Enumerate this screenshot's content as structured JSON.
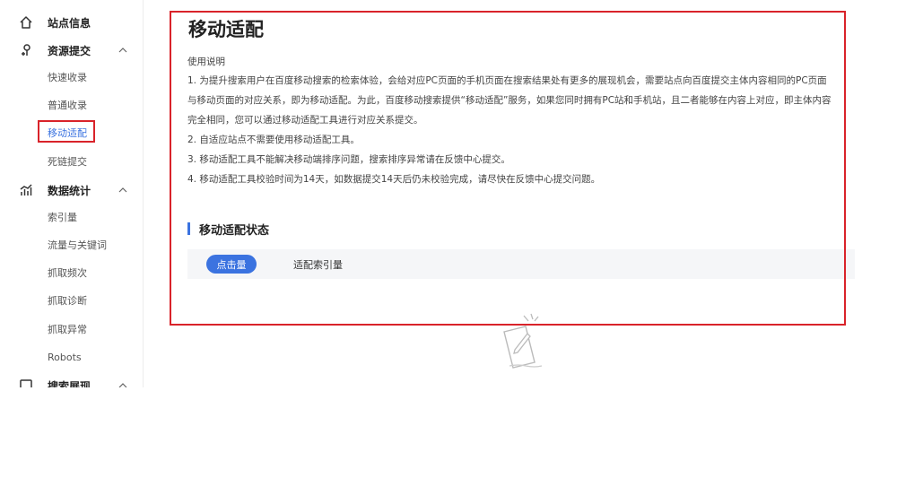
{
  "sidebar": {
    "groups": [
      {
        "label": "站点信息",
        "icon": "home-icon"
      },
      {
        "label": "资源提交",
        "icon": "submit-icon",
        "expanded": true,
        "items": [
          "快速收录",
          "普通收录",
          "移动适配",
          "死链提交"
        ]
      },
      {
        "label": "数据统计",
        "icon": "chart-icon",
        "expanded": true,
        "items": [
          "索引量",
          "流量与关键词",
          "抓取频次",
          "抓取诊断",
          "抓取异常",
          "Robots"
        ]
      },
      {
        "label": "搜索展现",
        "icon": "display-icon"
      }
    ],
    "active_item": "移动适配"
  },
  "main": {
    "title": "移动适配",
    "usage_title": "使用说明",
    "paragraphs": [
      "1. 为提升搜索用户在百度移动搜索的检索体验，会给对应PC页面的手机页面在搜索结果处有更多的展现机会，需要站点向百度提交主体内容相同的PC页面",
      "与移动页面的对应关系，即为移动适配。为此，百度移动搜索提供“移动适配”服务，如果您同时拥有PC站和手机站，且二者能够在内容上对应，即主体内容",
      "完全相同，您可以通过移动适配工具进行对应关系提交。",
      "2. 自适应站点不需要使用移动适配工具。",
      "3. 移动适配工具不能解决移动端排序问题，搜索排序异常请在反馈中心提交。",
      "4. 移动适配工具校验时间为14天，如数据提交14天后仍未校验完成，请尽快在反馈中心提交问题。"
    ],
    "section_title": "移动适配状态",
    "tabs": [
      {
        "label": "点击量",
        "active": true
      },
      {
        "label": "适配索引量",
        "active": false
      }
    ]
  },
  "colors": {
    "accent": "#3b73e0",
    "highlight_border": "#d9232a"
  }
}
